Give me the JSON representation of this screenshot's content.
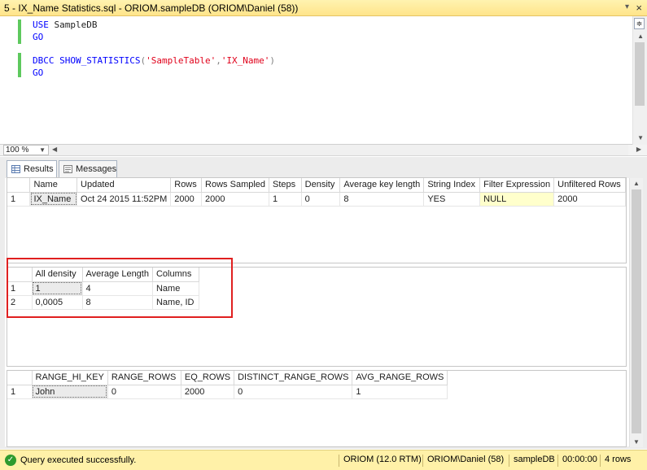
{
  "tab": {
    "title": "5 - IX_Name Statistics.sql - ORIOM.sampleDB (ORIOM\\Daniel (58))",
    "close": "×",
    "pin": "▾"
  },
  "editor": {
    "line1_kw": "USE",
    "line1_rest": " SampleDB",
    "line2": "GO",
    "line4_kw": "DBCC",
    "line4_fn": "SHOW_STATISTICS",
    "line4_open": "(",
    "line4_arg1": "'SampleTable'",
    "line4_comma": ",",
    "line4_arg2": "'IX_Name'",
    "line4_close": ")",
    "line5": "GO"
  },
  "zoom": {
    "value": "100 %"
  },
  "result_tabs": [
    {
      "label": "Results"
    },
    {
      "label": "Messages"
    }
  ],
  "grid1": {
    "headers": [
      "Name",
      "Updated",
      "Rows",
      "Rows Sampled",
      "Steps",
      "Density",
      "Average key length",
      "String Index",
      "Filter Expression",
      "Unfiltered Rows"
    ],
    "rows": [
      {
        "n": "1",
        "cells": [
          "IX_Name",
          "Oct 24 2015 11:52PM",
          "2000",
          "2000",
          "1",
          "0",
          "8",
          "YES",
          "NULL",
          "2000"
        ]
      }
    ]
  },
  "grid2": {
    "headers": [
      "All density",
      "Average Length",
      "Columns"
    ],
    "rows": [
      {
        "n": "1",
        "cells": [
          "1",
          "4",
          "Name"
        ]
      },
      {
        "n": "2",
        "cells": [
          "0,0005",
          "8",
          "Name, ID"
        ]
      }
    ]
  },
  "grid3": {
    "headers": [
      "RANGE_HI_KEY",
      "RANGE_ROWS",
      "EQ_ROWS",
      "DISTINCT_RANGE_ROWS",
      "AVG_RANGE_ROWS"
    ],
    "rows": [
      {
        "n": "1",
        "cells": [
          "John",
          "0",
          "2000",
          "0",
          "1"
        ]
      }
    ]
  },
  "status": {
    "message": "Query executed successfully.",
    "server": "ORIOM (12.0 RTM)",
    "user": "ORIOM\\Daniel (58)",
    "db": "sampleDB",
    "time": "00:00:00",
    "rows": "4 rows"
  },
  "colors": {
    "accent_yellow": "#fff1a8",
    "highlight_red": "#e02020",
    "gutter_green": "#5ec95e"
  }
}
